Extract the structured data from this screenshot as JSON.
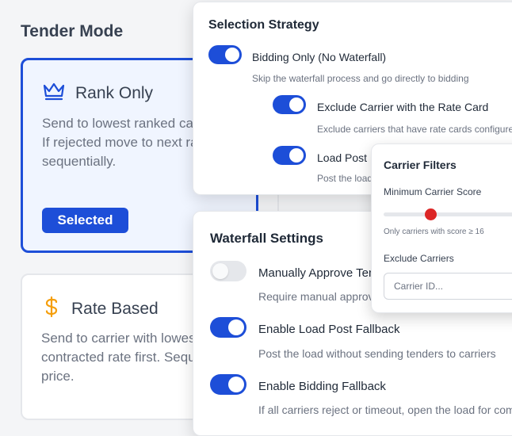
{
  "tender_mode": {
    "title": "Tender Mode",
    "cards": [
      {
        "name": "Rank Only",
        "icon": "crown-icon",
        "description": "Send to lowest ranked carrier first. If rejected move to next rank sequentially.",
        "selected_label": "Selected",
        "state": "selected"
      },
      {
        "name": "Rate Based",
        "icon": "dollar-icon",
        "description": "Send to carrier with lowest contracted rate first. Sequential by price.",
        "state": "unselected"
      }
    ]
  },
  "selection_strategy": {
    "title": "Selection Strategy",
    "options": [
      {
        "label": "Bidding Only (No Waterfall)",
        "description": "Skip the waterfall process and go directly to bidding",
        "enabled": true
      },
      {
        "label": "Exclude Carrier with the Rate Card",
        "description": "Exclude carriers that have rate cards configured",
        "enabled": true
      },
      {
        "label": "Load Post",
        "description": "Post the load",
        "enabled": true
      }
    ]
  },
  "carrier_filters": {
    "title": "Carrier Filters",
    "min_score_label": "Minimum Carrier Score",
    "min_score_value": 16,
    "min_score_fraction": 0.33,
    "min_score_hint": "Only carriers with score ≥ 16",
    "exclude_label": "Exclude Carriers",
    "exclude_placeholder": "Carrier ID..."
  },
  "waterfall_settings": {
    "title": "Waterfall Settings",
    "options": [
      {
        "label": "Manually Approve Tenders",
        "description": "Require manual approval",
        "enabled": false
      },
      {
        "label": "Enable Load Post Fallback",
        "description": "Post the load without sending tenders to carriers",
        "enabled": true
      },
      {
        "label": "Enable Bidding Fallback",
        "description": "If all carriers reject or timeout, open the load for competitive bidding",
        "enabled": true
      }
    ]
  },
  "colors": {
    "accent": "#1d4ed8",
    "danger": "#dc2626",
    "gold": "#f59e0b"
  }
}
